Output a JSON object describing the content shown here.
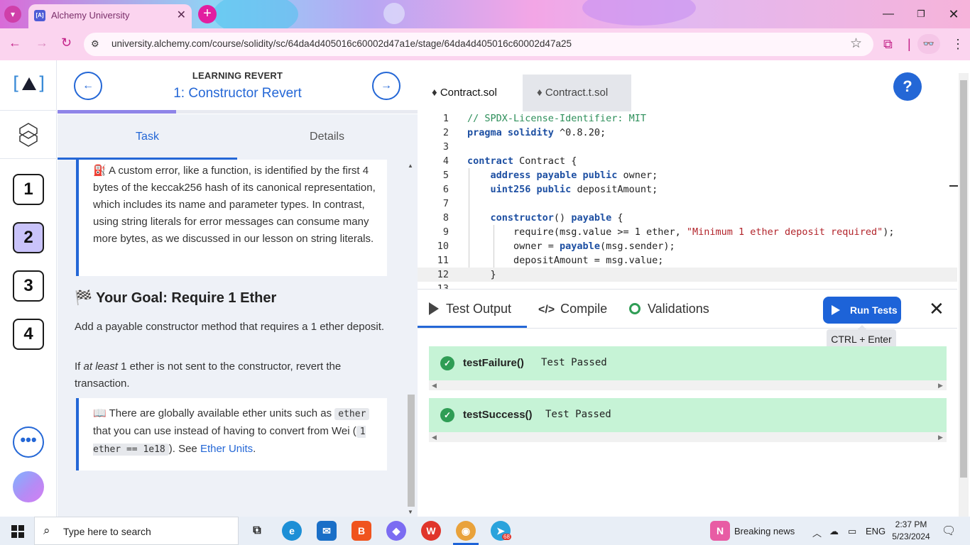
{
  "browser": {
    "tab_title": "Alchemy University",
    "url": "university.alchemy.com/course/solidity/sc/64da4d405016c60002d47a1e/stage/64da4d405016c60002d47a25"
  },
  "rail": {
    "logo_text": "[A]",
    "stages": [
      "1",
      "2",
      "3",
      "4"
    ],
    "more_label": "•••"
  },
  "lesson": {
    "kicker": "LEARNING REVERT",
    "title": "1: Constructor Revert",
    "progress_fraction": 0.33,
    "tabs": [
      "Task",
      "Details"
    ],
    "callout1": "A custom error, like a function, is identified by the first 4 bytes of the keccak256 hash of its canonical representation, which includes its name and parameter types. In contrast, using string literals for error messages can consume many more bytes, as we discussed in our lesson on string literals.",
    "goal_title": "Your Goal: Require 1 Ether",
    "para1": "Add a payable constructor method that requires a 1 ether deposit.",
    "para2_a": "If ",
    "para2_em": "at least",
    "para2_b": " 1 ether is not sent to the constructor, revert the transaction.",
    "callout2_a": "There are globally available ether units such as ",
    "callout2_code1": "ether",
    "callout2_b": " that you can use instead of having to convert from Wei (",
    "callout2_code2": "1 ether == 1e18",
    "callout2_c": "). See ",
    "callout2_link": "Ether Units",
    "callout2_d": "."
  },
  "editor": {
    "file_tabs": [
      "Contract.sol",
      "Contract.t.sol"
    ],
    "help_label": "?",
    "lines": [
      {
        "n": "1",
        "parts": [
          {
            "c": "cm",
            "t": "// SPDX-License-Identifier: MIT"
          }
        ]
      },
      {
        "n": "2",
        "parts": [
          {
            "c": "kw",
            "t": "pragma solidity"
          },
          {
            "c": "tx",
            "t": " ^0.8.20;"
          }
        ]
      },
      {
        "n": "3",
        "parts": []
      },
      {
        "n": "4",
        "parts": [
          {
            "c": "kw",
            "t": "contract"
          },
          {
            "c": "tx",
            "t": " Contract {"
          }
        ]
      },
      {
        "n": "5",
        "parts": [
          {
            "c": "tx",
            "t": "    "
          },
          {
            "c": "kw",
            "t": "address payable public"
          },
          {
            "c": "tx",
            "t": " owner;"
          }
        ]
      },
      {
        "n": "6",
        "parts": [
          {
            "c": "tx",
            "t": "    "
          },
          {
            "c": "kw",
            "t": "uint256 public"
          },
          {
            "c": "tx",
            "t": " depositAmount;"
          }
        ]
      },
      {
        "n": "7",
        "parts": []
      },
      {
        "n": "8",
        "parts": [
          {
            "c": "tx",
            "t": "    "
          },
          {
            "c": "kw",
            "t": "constructor"
          },
          {
            "c": "tx",
            "t": "() "
          },
          {
            "c": "kw",
            "t": "payable"
          },
          {
            "c": "tx",
            "t": " {"
          }
        ]
      },
      {
        "n": "9",
        "parts": [
          {
            "c": "tx",
            "t": "        require(msg.value >= 1 ether, "
          },
          {
            "c": "str",
            "t": "\"Minimum 1 ether deposit required\""
          },
          {
            "c": "tx",
            "t": ");"
          }
        ]
      },
      {
        "n": "10",
        "parts": [
          {
            "c": "tx",
            "t": "        owner = "
          },
          {
            "c": "kw",
            "t": "payable"
          },
          {
            "c": "tx",
            "t": "(msg.sender);"
          }
        ]
      },
      {
        "n": "11",
        "parts": [
          {
            "c": "tx",
            "t": "        depositAmount = msg.value;"
          }
        ]
      },
      {
        "n": "12",
        "parts": [
          {
            "c": "tx",
            "t": "    }"
          }
        ]
      },
      {
        "n": "13",
        "parts": []
      }
    ]
  },
  "tests": {
    "tabs": [
      "Test Output",
      "Compile",
      "Validations"
    ],
    "run_label": "Run Tests",
    "tooltip": "CTRL + Enter",
    "results": [
      {
        "name": "testFailure()",
        "status": "Test Passed"
      },
      {
        "name": "testSuccess()",
        "status": "Test Passed"
      }
    ]
  },
  "taskbar": {
    "search_placeholder": "Type here to search",
    "news": "Breaking news",
    "lang": "ENG",
    "time": "2:37 PM",
    "date": "5/23/2024",
    "telegram_badge": "68"
  }
}
